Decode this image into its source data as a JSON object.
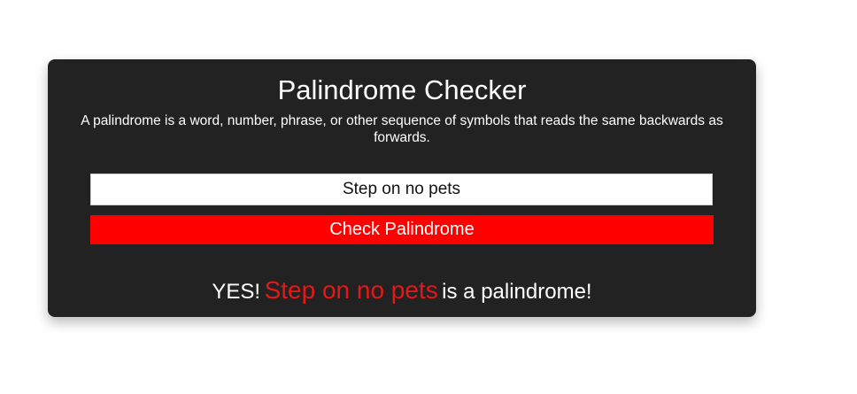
{
  "app": {
    "title": "Palindrome Checker",
    "description": "A palindrome is a word, number, phrase, or other sequence of symbols that reads the same backwards as forwards."
  },
  "form": {
    "input_value": "Step on no pets",
    "check_label": "Check Palindrome"
  },
  "result": {
    "prefix": "YES!",
    "word": "Step on no pets",
    "suffix": "is a palindrome!"
  },
  "colors": {
    "card_bg": "#232223",
    "accent_button": "#ff0000",
    "result_word": "#e61717",
    "text": "#ffffff"
  }
}
